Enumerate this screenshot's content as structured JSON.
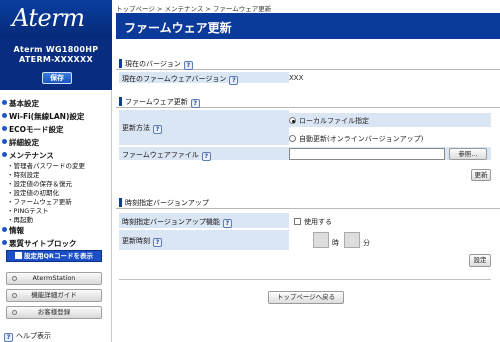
{
  "sidebar": {
    "logo": "Aterm",
    "model_line1": "Aterm WG1800HP",
    "model_line2": "ATERM-XXXXXX",
    "save_label": "保存",
    "nav": {
      "basic": "基本設定",
      "wifi": "Wi-Fi(無線LAN)設定",
      "eco": "ECOモード設定",
      "detail": "詳細設定",
      "maintenance": "メンテナンス",
      "info": "情報",
      "malicious": "悪質サイトブロック"
    },
    "maintenance_items": [
      "管理者パスワードの変更",
      "時刻設定",
      "設定値の保存＆復元",
      "設定値の初期化",
      "ファームウェア更新",
      "PINGテスト",
      "再起動"
    ],
    "qr_button": "設定用QRコードを表示",
    "buttons": [
      "AtermStation",
      "機能詳細ガイド",
      "お客様登録"
    ],
    "help": "ヘルプ表示"
  },
  "breadcrumb": "トップページ > メンテナンス > ファームウェア更新",
  "page_title": "ファームウェア更新",
  "current_version": {
    "section": "現在のバージョン",
    "label": "現在のファームウェアバージョン",
    "value": "XXX"
  },
  "firmware_update": {
    "section": "ファームウェア更新",
    "method_label": "更新方法",
    "option_local": "ローカルファイル指定",
    "option_auto": "自動更新(オンラインバージョンアップ)",
    "file_label": "ファームウェアファイル",
    "file_value": "",
    "browse_button": "参照...",
    "update_button": "更新"
  },
  "scheduled_update": {
    "section": "時刻指定バージョンアップ",
    "feature_label": "時刻指定バージョンアップ機能",
    "use_label": "使用する",
    "time_label": "更新時刻",
    "hour_unit": "時",
    "minute_unit": "分",
    "set_button": "設定"
  },
  "back_button": "トップページへ戻る",
  "help_icon": "?",
  "colors": {
    "header_blue": "#0a3a9a",
    "row_blue": "#dbe6f4"
  }
}
